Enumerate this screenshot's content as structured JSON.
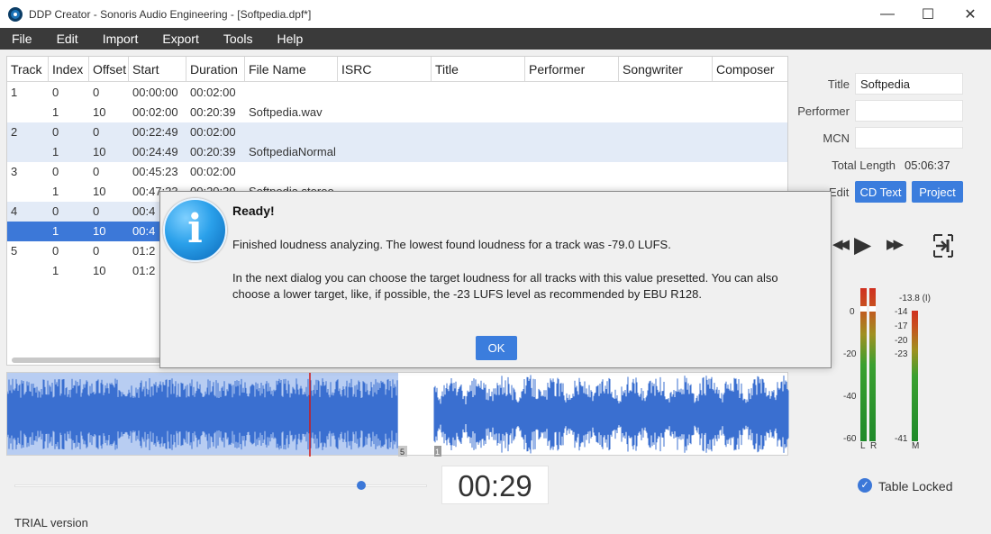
{
  "window": {
    "title": "DDP Creator - Sonoris Audio Engineering - [Softpedia.dpf*]",
    "minimize": "—",
    "maximize": "☐",
    "close": "✕"
  },
  "menu": [
    "File",
    "Edit",
    "Import",
    "Export",
    "Tools",
    "Help"
  ],
  "table": {
    "columns": [
      "Track",
      "Index",
      "Offset",
      "Start",
      "Duration",
      "File Name",
      "ISRC",
      "Title",
      "Performer",
      "Songwriter",
      "Composer"
    ],
    "rows": [
      [
        "1",
        "0",
        "0",
        "00:00:00",
        "00:02:00",
        "",
        "",
        "",
        "",
        "",
        ""
      ],
      [
        "",
        "1",
        "10",
        "00:02:00",
        "00:20:39",
        "Softpedia.wav",
        "",
        "",
        "",
        "",
        ""
      ],
      [
        "2",
        "0",
        "0",
        "00:22:49",
        "00:02:00",
        "",
        "",
        "",
        "",
        "",
        ""
      ],
      [
        "",
        "1",
        "10",
        "00:24:49",
        "00:20:39",
        "SoftpediaNormal",
        "",
        "",
        "",
        "",
        ""
      ],
      [
        "3",
        "0",
        "0",
        "00:45:23",
        "00:02:00",
        "",
        "",
        "",
        "",
        "",
        ""
      ],
      [
        "",
        "1",
        "10",
        "00:47:23",
        "00:20:39",
        "Softpedia.stereo",
        "",
        "",
        "",
        "",
        ""
      ],
      [
        "4",
        "0",
        "0",
        "00:4",
        "",
        "",
        "",
        "",
        "",
        "",
        ""
      ],
      [
        "",
        "1",
        "10",
        "00:4",
        "",
        "",
        "",
        "",
        "",
        "",
        ""
      ],
      [
        "5",
        "0",
        "0",
        "01:2",
        "",
        "",
        "",
        "",
        "",
        "",
        ""
      ],
      [
        "",
        "1",
        "10",
        "01:2",
        "",
        "",
        "",
        "",
        "",
        "",
        ""
      ]
    ]
  },
  "waveform": {
    "markers": [
      "5",
      "1"
    ]
  },
  "cdtext": {
    "title_label": "Title",
    "title_value": "Softpedia",
    "performer_label": "Performer",
    "performer_value": "",
    "mcn_label": "MCN",
    "mcn_value": "",
    "total_length_label": "Total Length",
    "total_length_value": "05:06:37",
    "edit_label": "Edit",
    "cdtext_button": "CD Text",
    "project_button": "Project"
  },
  "transport": {
    "rewind": "◀◀",
    "play": "▶",
    "forward": "▶▶"
  },
  "meters": {
    "left_scale": [
      "0",
      "-20",
      "-40",
      "-60"
    ],
    "right_peak": "-13.8 (I)",
    "right_scale": [
      "-14",
      "-17",
      "-20",
      "-23",
      "-41"
    ],
    "labels": [
      "L",
      "R",
      "M"
    ]
  },
  "position": {
    "time": "00:29",
    "slider_fraction": 0.84
  },
  "table_locked_label": "Table Locked",
  "trial_label": "TRIAL version",
  "dialog": {
    "title": "Ready!",
    "message1": "Finished loudness analyzing. The lowest found loudness for a track was -79.0 LUFS.",
    "message2": "In the next dialog you can choose the target loudness for all tracks with this value presetted. You can also choose a lower target, like, if possible, the -23 LUFS level as recommended by EBU R128.",
    "ok": "OK",
    "icon": "info-icon"
  },
  "colors": {
    "accent": "#3b7ddd",
    "waveform": "#3a6fd0",
    "selection": "#3c78d8"
  }
}
